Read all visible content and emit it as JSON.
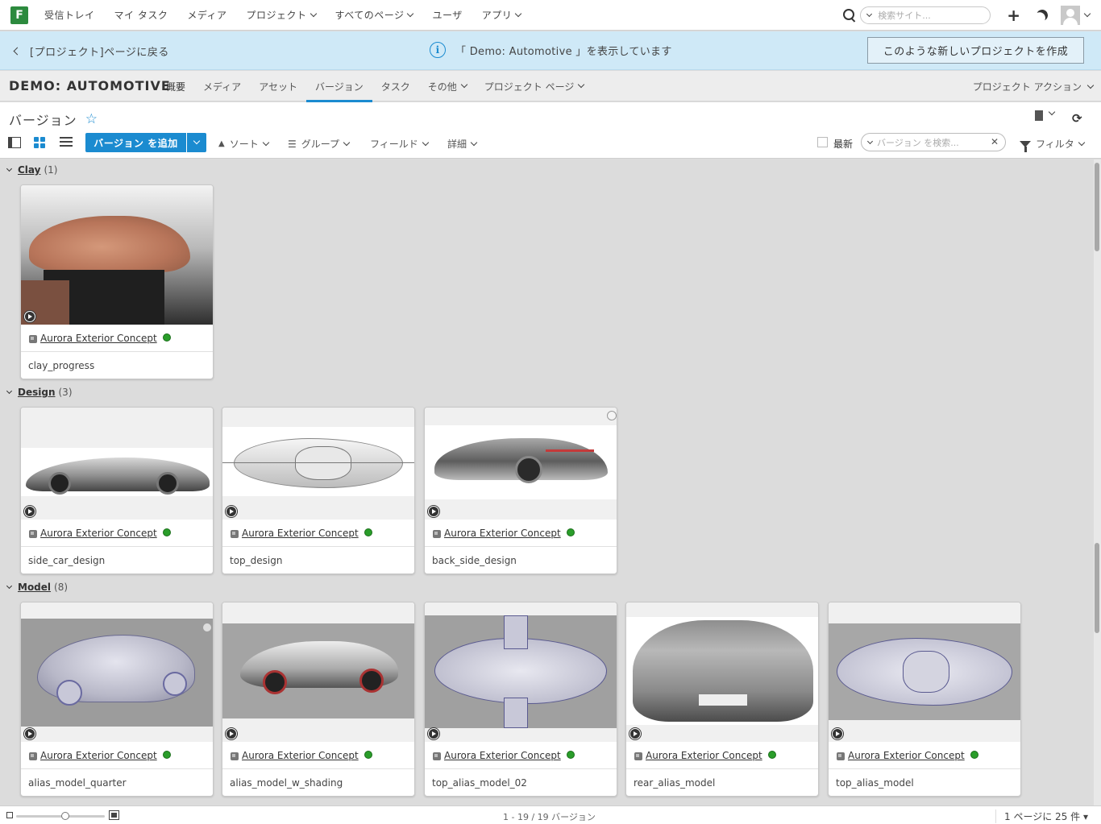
{
  "topnav": {
    "logo": "F",
    "items": [
      {
        "label": "受信トレイ",
        "dropdown": false
      },
      {
        "label": "マイ タスク",
        "dropdown": false
      },
      {
        "label": "メディア",
        "dropdown": false
      },
      {
        "label": "プロジェクト",
        "dropdown": true
      },
      {
        "label": "すべてのページ",
        "dropdown": true
      },
      {
        "label": "ユーザ",
        "dropdown": false
      },
      {
        "label": "アプリ",
        "dropdown": true
      }
    ],
    "search_placeholder": "検索サイト..."
  },
  "banner": {
    "back_label": "[プロジェクト]ページに戻る",
    "message": "「 Demo: Automotive 」を表示しています",
    "create_button": "このような新しいプロジェクトを作成"
  },
  "project": {
    "name": "DEMO: AUTOMOTIVE",
    "tabs": [
      {
        "label": "概要",
        "dropdown": false
      },
      {
        "label": "メディア",
        "dropdown": false
      },
      {
        "label": "アセット",
        "dropdown": false
      },
      {
        "label": "バージョン",
        "dropdown": false,
        "active": true
      },
      {
        "label": "タスク",
        "dropdown": false
      },
      {
        "label": "その他",
        "dropdown": true
      },
      {
        "label": "プロジェクト ページ",
        "dropdown": true
      }
    ],
    "actions_label": "プロジェクト アクション"
  },
  "page": {
    "title": "バージョン",
    "add_button": "バージョン を追加",
    "sort_label": "ソート",
    "group_label": "グループ",
    "fields_label": "フィールド",
    "more_label": "詳細",
    "latest_label": "最新",
    "search_placeholder": "バージョン を検索...",
    "filter_label": "フィルタ"
  },
  "groups": [
    {
      "name": "Clay",
      "count": "(1)",
      "cards": [
        {
          "entity": "Aurora Exterior Concept",
          "version": "clay_progress"
        }
      ]
    },
    {
      "name": "Design",
      "count": "(3)",
      "cards": [
        {
          "entity": "Aurora Exterior Concept",
          "version": "side_car_design"
        },
        {
          "entity": "Aurora Exterior Concept",
          "version": "top_design"
        },
        {
          "entity": "Aurora Exterior Concept",
          "version": "back_side_design"
        }
      ]
    },
    {
      "name": "Model",
      "count": "(8)",
      "cards": [
        {
          "entity": "Aurora Exterior Concept",
          "version": "alias_model_quarter"
        },
        {
          "entity": "Aurora Exterior Concept",
          "version": "alias_model_w_shading"
        },
        {
          "entity": "Aurora Exterior Concept",
          "version": "top_alias_model_02"
        },
        {
          "entity": "Aurora Exterior Concept",
          "version": "rear_alias_model"
        },
        {
          "entity": "Aurora Exterior Concept",
          "version": "top_alias_model"
        }
      ]
    }
  ],
  "footer": {
    "page_info": "1 - 19 / 19 バージョン",
    "per_page": "1 ページに 25 件"
  },
  "colors": {
    "accent": "#1b8bd0",
    "banner": "#cfe9f7",
    "status": "#2a9d2a"
  }
}
